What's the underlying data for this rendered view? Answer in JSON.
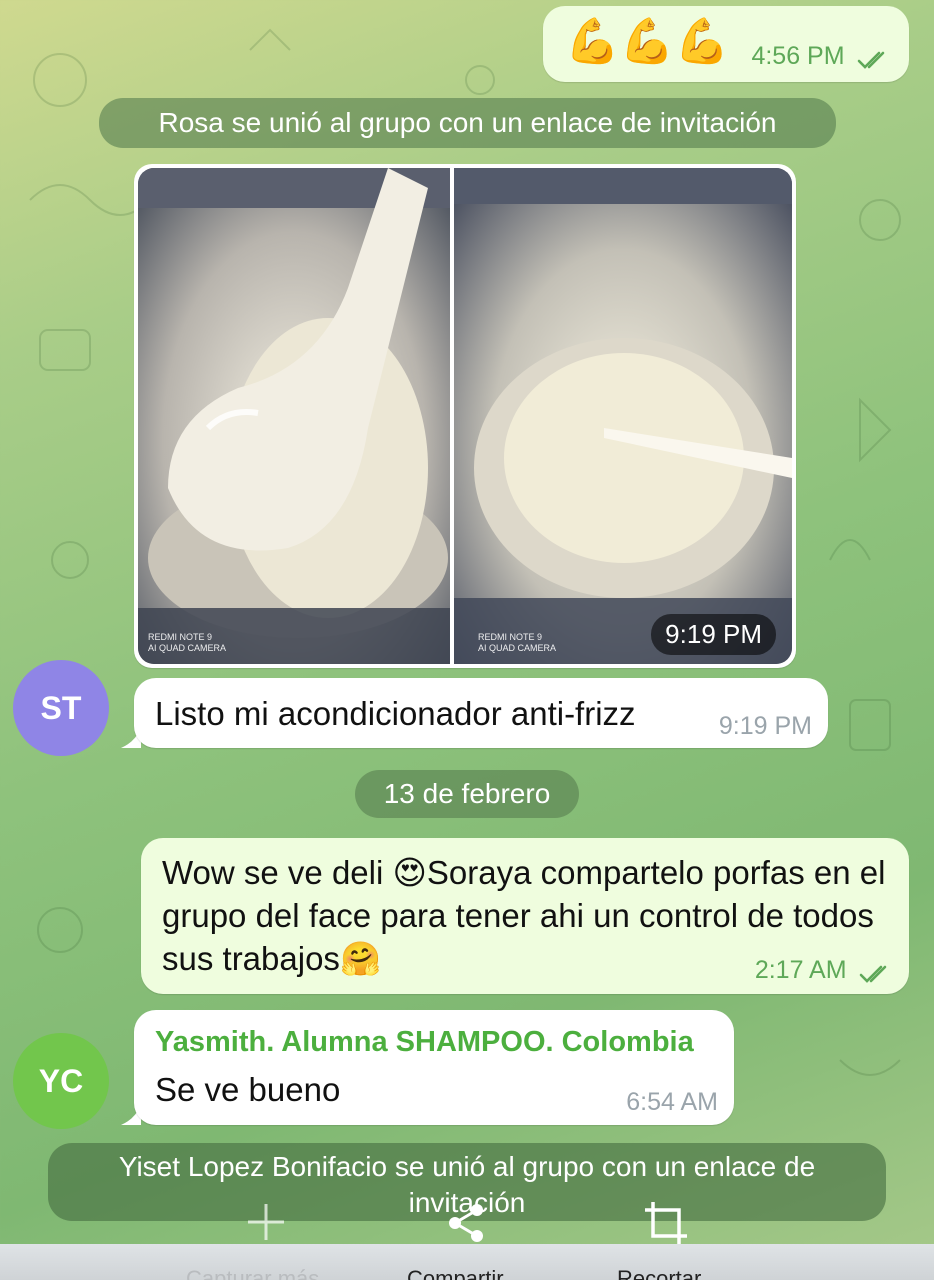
{
  "messages": {
    "emoji_message": {
      "emoji": "💪💪💪",
      "time": "4:56 PM"
    },
    "service_rosa": "Rosa se unió al grupo con un enlace de invitación",
    "photos": {
      "left_camera_line1": "REDMI NOTE 9",
      "left_camera_line2": "AI QUAD CAMERA",
      "right_camera_line1": "REDMI NOTE 9",
      "right_camera_line2": "AI QUAD CAMERA",
      "time": "9:19 PM"
    },
    "st_message": {
      "avatar_initials": "ST",
      "text": "Listo mi acondicionador anti-frizz",
      "time": "9:19 PM"
    },
    "date_separator": "13 de febrero",
    "wow_message": {
      "text_part1": "Wow se ve deli ",
      "emoji1": "😍",
      "text_part2": "Soraya compartelo porfas en el grupo del face para tener ahi un control de todos sus trabajos",
      "emoji2": "🤗",
      "time": "2:17 AM"
    },
    "yc_message": {
      "avatar_initials": "YC",
      "sender": "Yasmith. Alumna SHAMPOO. Colombia",
      "text": "Se  ve bueno",
      "time": "6:54 AM"
    },
    "service_yiset": "Yiset Lopez Bonifacio se unió al grupo con un enlace de invitación"
  },
  "toolbar": {
    "capture_more": "Capturar más",
    "share": "Compartir",
    "crop": "Recortar"
  },
  "colors": {
    "outgoing_bubble": "#effdde",
    "incoming_bubble": "#ffffff",
    "time_green": "#5ea858",
    "sender_green": "#4caf3e",
    "avatar_st": "#8f85e6",
    "avatar_yc": "#72c64c"
  },
  "icons": [
    "double-check-icon",
    "plus-icon",
    "share-icon",
    "crop-icon"
  ]
}
